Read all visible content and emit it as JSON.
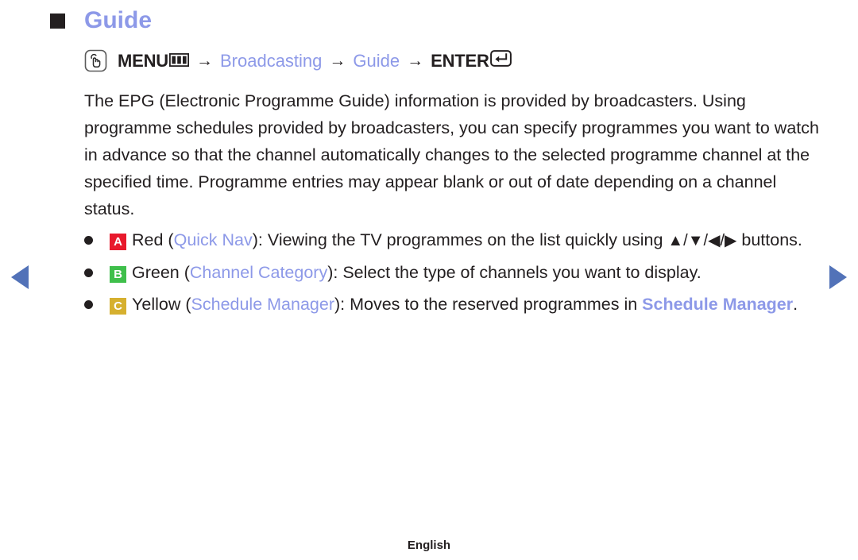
{
  "page": {
    "title": "Guide",
    "title_bullet_icon": "dark-square-bullet"
  },
  "menu_path": {
    "touch_icon": "hand-touch-icon",
    "menu_label": "MENU",
    "menu_icon": "menu-grid-icon",
    "arrow1": "→",
    "step1": "Broadcasting",
    "arrow2": "→",
    "step2": "Guide",
    "arrow3": "→",
    "enter_label": "ENTER",
    "enter_icon": "enter-key-icon"
  },
  "body": {
    "paragraph": "The EPG (Electronic Programme Guide) information is provided by broadcasters. Using programme schedules provided by broadcasters, you can specify programmes you want to watch in advance so that the channel automatically changes to the selected programme channel at the specified time. Programme entries may appear blank or out of date depending on a channel status."
  },
  "bullets": [
    {
      "badge": "A",
      "badge_color": "#e8192c",
      "color_name": "Red",
      "open_paren": " (",
      "feature": "Quick Nav",
      "close_paren": "): ",
      "text_before_keys": "Viewing the TV programmes on the list quickly using ",
      "keys": "▲/▼/◀/▶",
      "text_after_keys": " buttons."
    },
    {
      "badge": "B",
      "badge_color": "#3fbf4b",
      "color_name": "Green",
      "open_paren": " (",
      "feature": "Channel Category",
      "close_paren": "): ",
      "description": "Select the type of channels you want to display."
    },
    {
      "badge": "C",
      "badge_color": "#d6b02f",
      "color_name": "Yellow",
      "open_paren": " (",
      "feature": "Schedule Manager",
      "close_paren": "): ",
      "description_before_link": "Moves to the reserved programmes in ",
      "link": "Schedule Manager",
      "description_after_link": "."
    }
  ],
  "navigation": {
    "prev_icon": "arrow-left-icon",
    "next_icon": "arrow-right-icon",
    "accent_color": "#5272b8"
  },
  "footer": {
    "language": "English"
  }
}
